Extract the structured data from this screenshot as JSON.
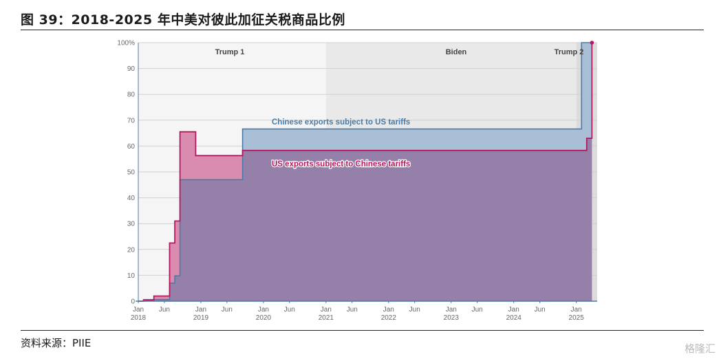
{
  "header": {
    "title": "图 39：2018-2025 年中美对彼此加征关税商品比例"
  },
  "footer": {
    "source": "资料来源：PIIE",
    "watermark": "格隆汇"
  },
  "colors": {
    "china_series": "#4a7ba6",
    "china_fill": "#a9bfd6",
    "us_series": "#b5175e",
    "us_fill": "#d98bb0",
    "overlap_fill": "#9480a8",
    "trump1_band": "#f5f5f5",
    "biden_band": "#e9e9e9",
    "trump2_band": "#dcdcdc",
    "grid": "#d0d0d0",
    "axis": "#4a7ba6"
  },
  "chart_data": {
    "type": "area",
    "title": "",
    "xlabel": "",
    "ylabel": "",
    "ylim": [
      0,
      100
    ],
    "yticks": [
      0,
      10,
      20,
      30,
      40,
      50,
      60,
      70,
      80,
      90,
      100
    ],
    "ytick_labels": [
      "0",
      "10",
      "20",
      "30",
      "40",
      "50",
      "60",
      "70",
      "80",
      "90",
      "100%"
    ],
    "xlim": [
      "2018-01",
      "2025-05"
    ],
    "xticks": [
      {
        "date": "2018-01",
        "label": [
          "Jan",
          "2018"
        ]
      },
      {
        "date": "2018-06",
        "label": [
          "Jun"
        ]
      },
      {
        "date": "2019-01",
        "label": [
          "Jan",
          "2019"
        ]
      },
      {
        "date": "2019-06",
        "label": [
          "Jun"
        ]
      },
      {
        "date": "2020-01",
        "label": [
          "Jan",
          "2020"
        ]
      },
      {
        "date": "2020-06",
        "label": [
          "Jun"
        ]
      },
      {
        "date": "2021-01",
        "label": [
          "Jan",
          "2021"
        ]
      },
      {
        "date": "2021-06",
        "label": [
          "Jun"
        ]
      },
      {
        "date": "2022-01",
        "label": [
          "Jan",
          "2022"
        ]
      },
      {
        "date": "2022-06",
        "label": [
          "Jun"
        ]
      },
      {
        "date": "2023-01",
        "label": [
          "Jan",
          "2023"
        ]
      },
      {
        "date": "2023-06",
        "label": [
          "Jun"
        ]
      },
      {
        "date": "2024-01",
        "label": [
          "Jan",
          "2024"
        ]
      },
      {
        "date": "2024-06",
        "label": [
          "Jun"
        ]
      },
      {
        "date": "2025-01",
        "label": [
          "Jan",
          "2025"
        ]
      }
    ],
    "eras": [
      {
        "label": "Trump 1",
        "start": "2018-01",
        "end": "2021-01"
      },
      {
        "label": "Biden",
        "start": "2021-01",
        "end": "2025-01"
      },
      {
        "label": "Trump 2",
        "start": "2025-01",
        "end": "2025-05"
      }
    ],
    "grid": true,
    "series": [
      {
        "name": "Chinese exports subject to US tariffs",
        "step": true,
        "points": [
          [
            "2018-01",
            0.0
          ],
          [
            "2018-02",
            0.6
          ],
          [
            "2018-07",
            7.0
          ],
          [
            "2018-08",
            9.8
          ],
          [
            "2018-09",
            47.0
          ],
          [
            "2019-09",
            66.6
          ],
          [
            "2025-02",
            100.0
          ],
          [
            "2025-04",
            100.0
          ]
        ]
      },
      {
        "name": "US exports subject to Chinese tariffs",
        "step": true,
        "points": [
          [
            "2018-01",
            0.0
          ],
          [
            "2018-02",
            0.4
          ],
          [
            "2018-04",
            2.0
          ],
          [
            "2018-07",
            22.5
          ],
          [
            "2018-08",
            31.0
          ],
          [
            "2018-09",
            65.5
          ],
          [
            "2018-12",
            56.3
          ],
          [
            "2019-09",
            58.3
          ],
          [
            "2025-03",
            63.0
          ],
          [
            "2025-04",
            100.0
          ]
        ],
        "end_marker": true
      }
    ]
  }
}
